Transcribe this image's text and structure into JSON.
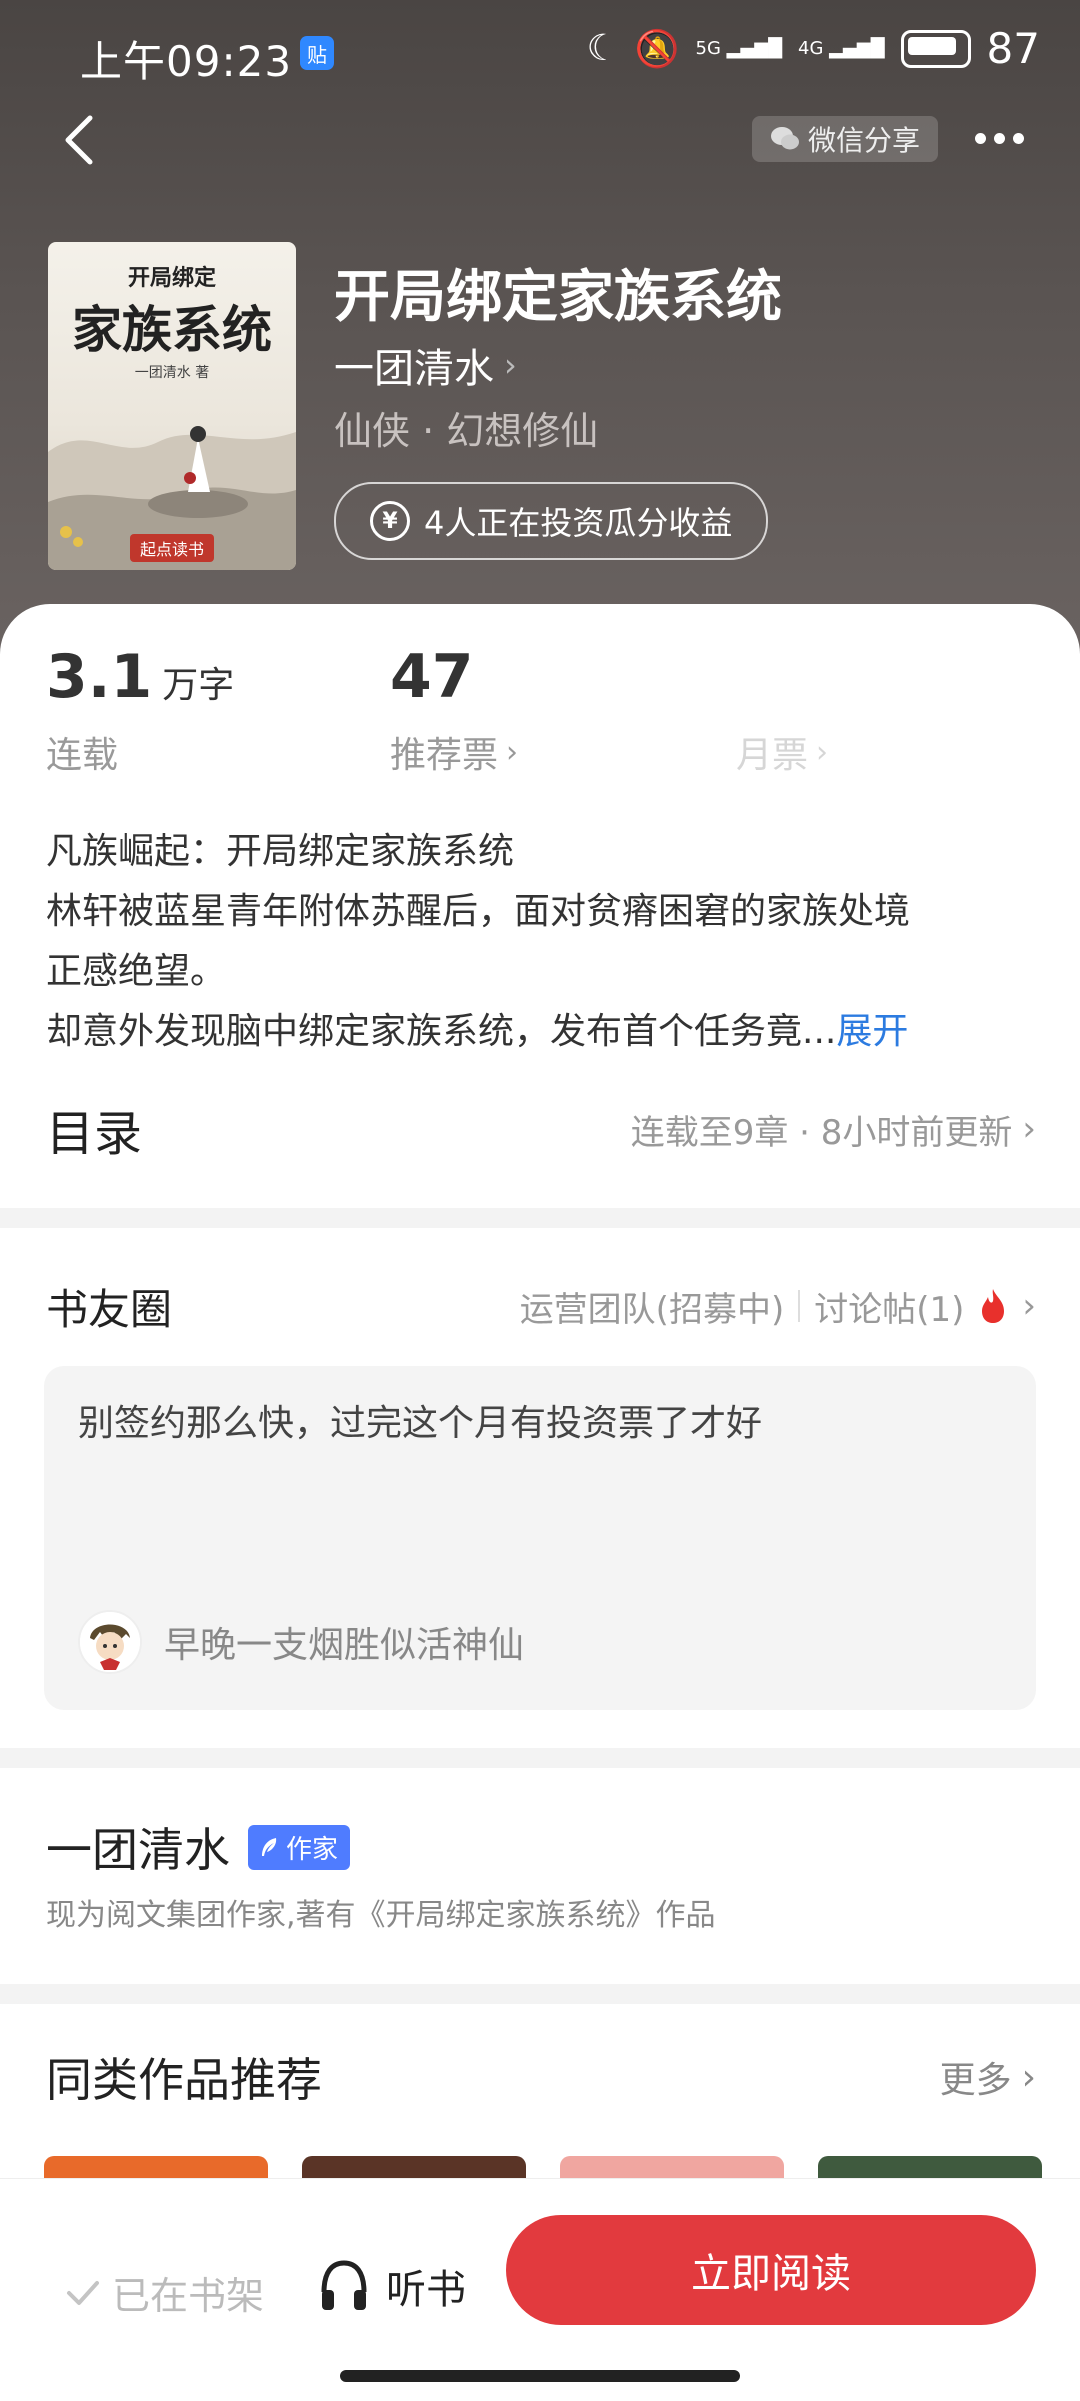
{
  "status_bar": {
    "time": "上午09:23",
    "badge": "贴",
    "network": "5G",
    "network2": "4G",
    "battery": "87"
  },
  "nav": {
    "share_label": "微信分享"
  },
  "book": {
    "cover_subtitle": "开局绑定",
    "cover_title": "家族系统",
    "cover_author": "一团清水 著",
    "cover_logo": "起点读书",
    "title": "开局绑定家族系统",
    "author": "一团清水",
    "genre": "仙侠 · 幻想修仙",
    "invest_text": "4人正在投资瓜分收益"
  },
  "stats": {
    "words_value": "3.1",
    "words_unit": "万字",
    "words_label": "连载",
    "votes_value": "47",
    "votes_label": "推荐票",
    "monthly_label": "月票"
  },
  "synopsis": {
    "line1": "凡族崛起：开局绑定家族系统",
    "line2": "林轩被蓝星青年附体苏醒后，面对贫瘠困窘的家族处境",
    "line3": "正感绝望。",
    "line4": "却意外发现脑中绑定家族系统，发布首个任务竟...",
    "expand": "展开"
  },
  "toc": {
    "title": "目录",
    "meta": "连载至9章 · 8小时前更新"
  },
  "circle": {
    "title": "书友圈",
    "ops_team": "运营团队(招募中)",
    "discussions": "讨论帖(1)",
    "post_text": "别签约那么快，过完这个月有投资票了才好",
    "post_user": "早晚一支烟胜似活神仙"
  },
  "author_section": {
    "name": "一团清水",
    "tag": "作家",
    "desc": "现为阅文集团作家,著有《开局绑定家族系统》作品"
  },
  "recommend": {
    "title": "同类作品推荐",
    "more": "更多",
    "thumb_colors": [
      "#e86a2a",
      "#5a3426",
      "#f0a6a0",
      "#3f5a3e"
    ]
  },
  "bottom_bar": {
    "shelf": "已在书架",
    "listen": "听书",
    "read": "立即阅读"
  },
  "colors": {
    "accent_red": "#e23a3e",
    "link_blue": "#2c7be0",
    "author_tag": "#4f7cff"
  }
}
